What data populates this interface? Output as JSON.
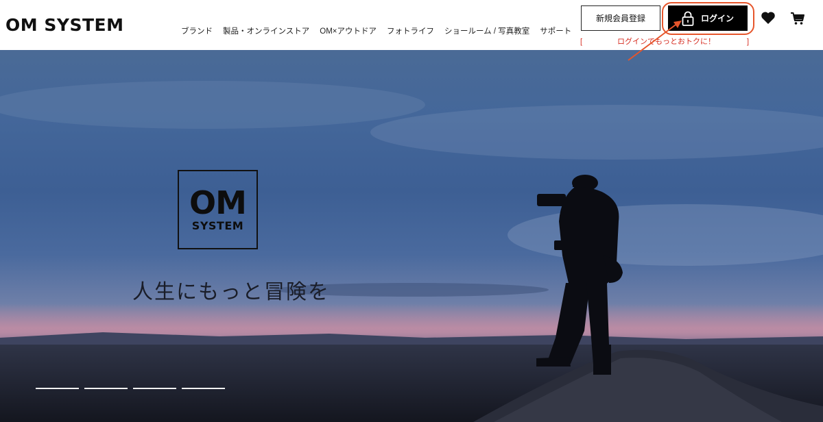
{
  "header": {
    "logo_text": "OM SYSTEM",
    "nav": [
      {
        "label": "ブランド"
      },
      {
        "label": "製品・オンラインストア"
      },
      {
        "label": "OM×アウトドア"
      },
      {
        "label": "フォトライフ"
      },
      {
        "label": "ショールーム / 写真教室"
      },
      {
        "label": "サポート"
      }
    ],
    "register_label": "新規会員登録",
    "login_label": "ログイン",
    "promo_text": "ログインでもっとおトクに！",
    "promo_bracket_left": "[",
    "promo_bracket_right": "]",
    "icons": {
      "login": "lock-icon",
      "favorites": "heart-icon",
      "cart": "cart-icon"
    },
    "annotation_color": "#e6552b"
  },
  "hero": {
    "logo_top": "OM",
    "logo_bottom": "SYSTEM",
    "tagline": "人生にもっと冒険を",
    "slides_count": 4
  },
  "colors": {
    "brand_black": "#000000",
    "promo_red": "#d62b1f"
  }
}
